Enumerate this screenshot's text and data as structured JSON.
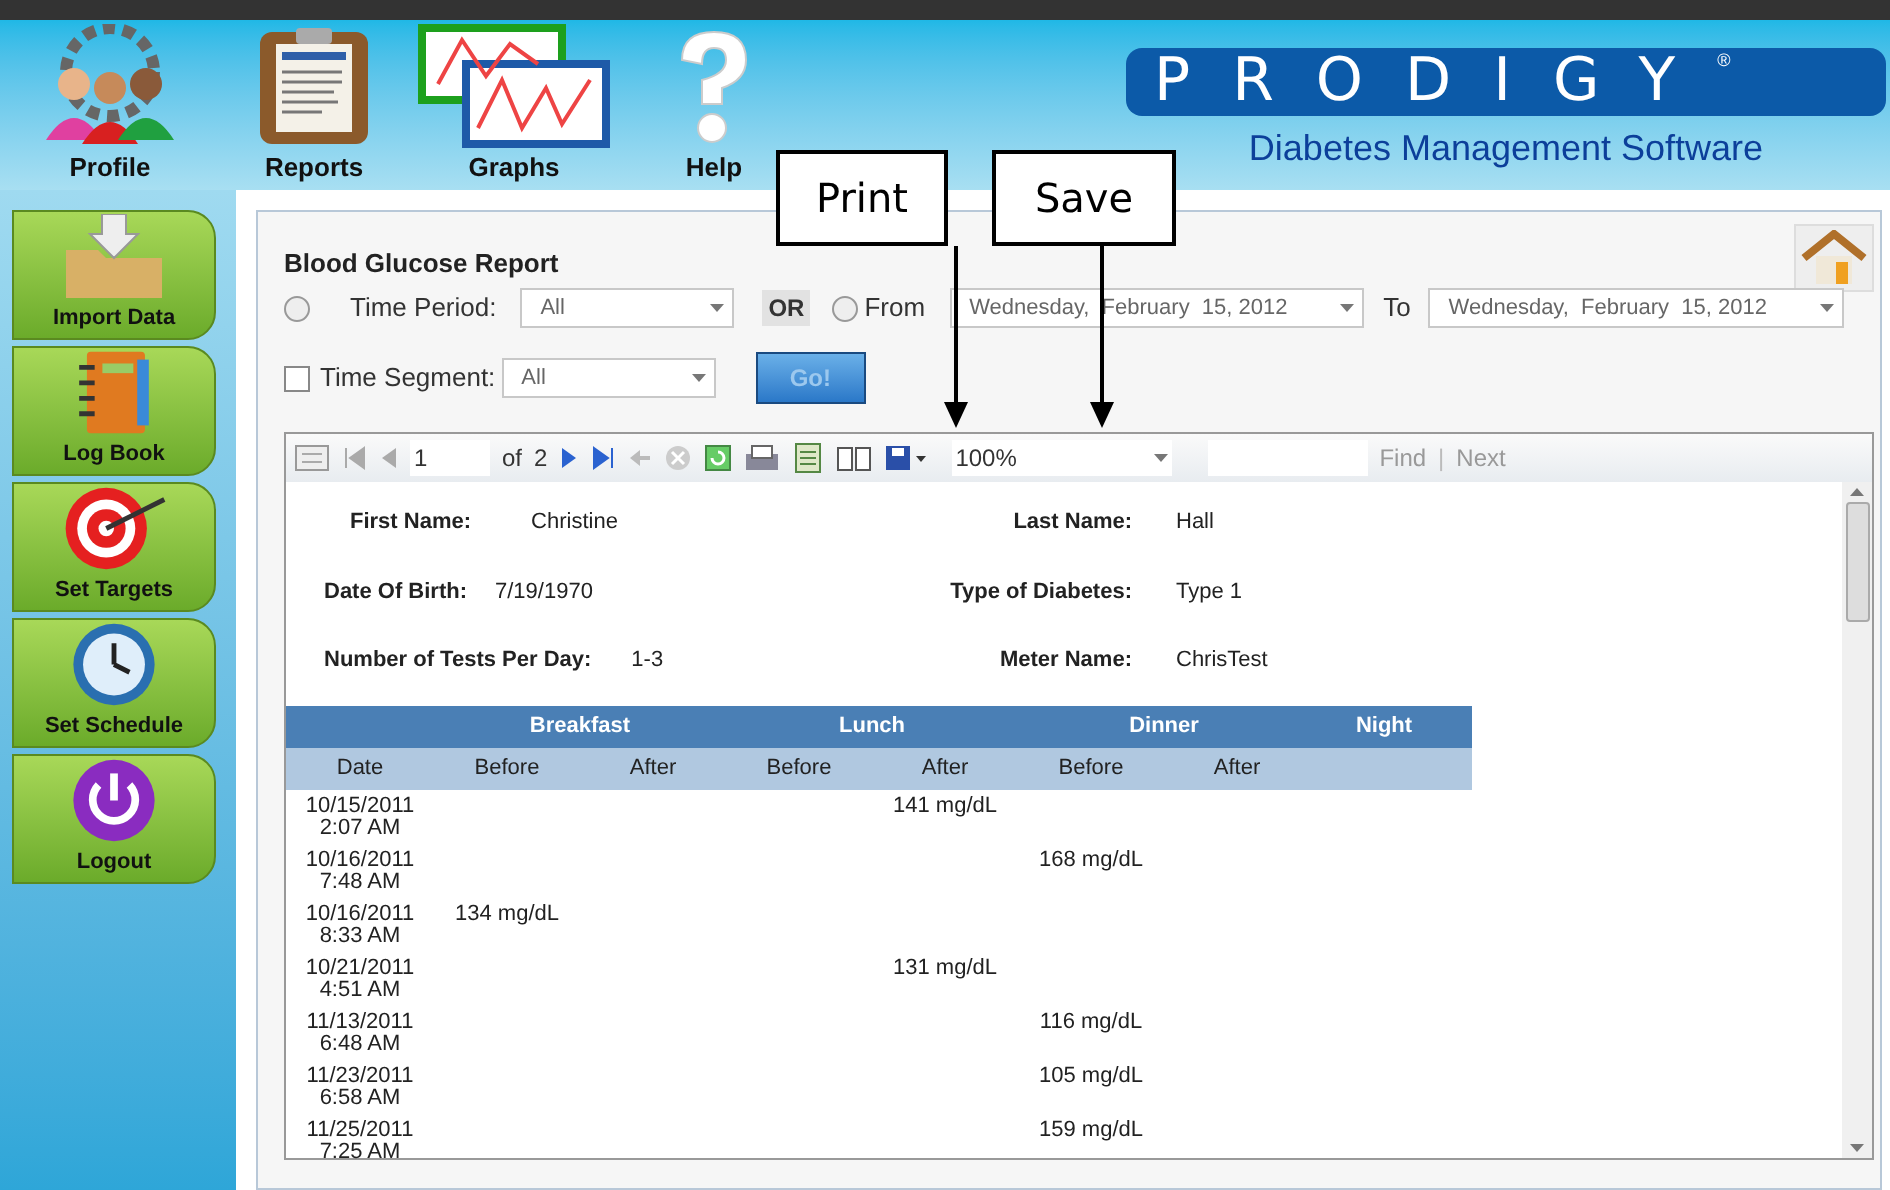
{
  "top_nav": [
    {
      "kind": "profile",
      "label": "Profile"
    },
    {
      "kind": "reports",
      "label": "Reports"
    },
    {
      "kind": "graphs",
      "label": "Graphs"
    },
    {
      "kind": "help",
      "label": "Help"
    }
  ],
  "brand": {
    "name": "PRODIGY",
    "mark": "®",
    "tagline": "Diabetes Management Software"
  },
  "sidebar": [
    {
      "kind": "import",
      "label": "Import Data"
    },
    {
      "kind": "logbook",
      "label": "Log Book"
    },
    {
      "kind": "targets",
      "label": "Set Targets"
    },
    {
      "kind": "schedule",
      "label": "Set Schedule"
    },
    {
      "kind": "logout",
      "label": "Logout"
    }
  ],
  "report_title": "Blood Glucose Report",
  "filters": {
    "time_period": {
      "label": "Time Period:",
      "checked": false,
      "value": "All"
    },
    "or_label": "OR",
    "from": {
      "label": "From",
      "checked": false,
      "value": "Wednesday,  February  15, 2012"
    },
    "to": {
      "label": "To",
      "value": "Wednesday,  February  15, 2012"
    },
    "time_segment": {
      "label": "Time Segment:",
      "checked": false,
      "value": "All"
    },
    "go_button": "Go!"
  },
  "callouts": [
    {
      "kind": "print",
      "label": "Print"
    },
    {
      "kind": "save",
      "label": "Save"
    }
  ],
  "toolbar": {
    "page": "1",
    "of": "of",
    "total": "2",
    "zoom": "100%",
    "find": "Find",
    "separator": "|",
    "next": "Next"
  },
  "patient": [
    {
      "label": "First Name:",
      "value": "Christine"
    },
    {
      "label": "Last Name:",
      "value": "Hall"
    },
    {
      "label": "Date Of Birth:",
      "value": "7/19/1970"
    },
    {
      "label": "Type of Diabetes:",
      "value": "Type 1"
    },
    {
      "label": "Number of Tests Per Day:",
      "value": "1-3"
    },
    {
      "label": "Meter Name:",
      "value": "ChrisTest"
    }
  ],
  "table": {
    "groups": [
      "Breakfast",
      "Lunch",
      "Dinner",
      "Night"
    ],
    "columns": [
      "Date",
      "Before",
      "After",
      "Before",
      "After",
      "Before",
      "After"
    ],
    "rows": [
      {
        "date": "10/15/2011",
        "time": "2:07 AM",
        "lunch_after": "141 mg/dL"
      },
      {
        "date": "10/16/2011",
        "time": "7:48 AM",
        "dinner_before": "168 mg/dL"
      },
      {
        "date": "10/16/2011",
        "time": "8:33 AM",
        "breakfast_before": "134 mg/dL"
      },
      {
        "date": "10/21/2011",
        "time": "4:51 AM",
        "lunch_after": "131 mg/dL"
      },
      {
        "date": "11/13/2011",
        "time": "6:48 AM",
        "dinner_before": "116 mg/dL"
      },
      {
        "date": "11/23/2011",
        "time": "6:58 AM",
        "dinner_before": "105 mg/dL"
      },
      {
        "date": "11/25/2011",
        "time": "7:25 AM",
        "dinner_before": "159 mg/dL"
      }
    ]
  }
}
